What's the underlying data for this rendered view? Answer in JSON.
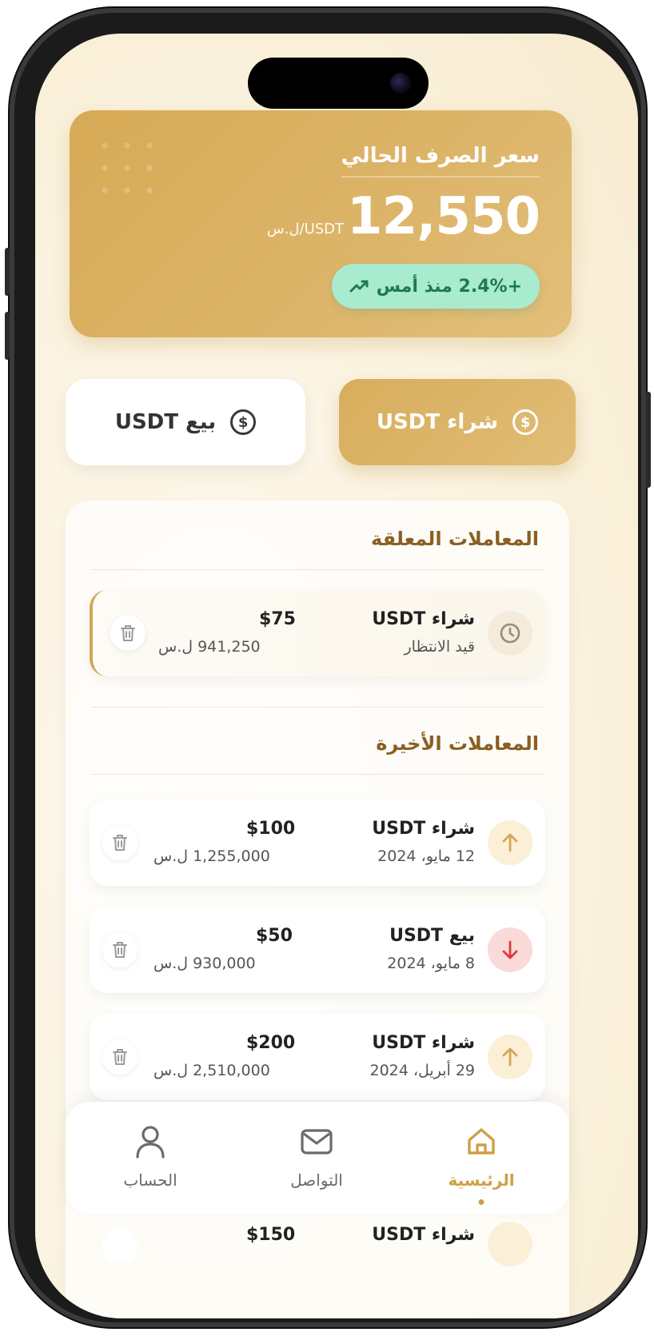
{
  "rate": {
    "title": "سعر الصرف الحالي",
    "value": "12,550",
    "unit": "ل.س/USDT",
    "change": "+2.4% منذ أمس"
  },
  "actions": {
    "buy_label": "شراء USDT",
    "sell_label": "بيع USDT"
  },
  "pending": {
    "title": "المعاملات المعلقة",
    "items": [
      {
        "title": "شراء USDT",
        "status": "قيد الانتظار",
        "amount": "$75",
        "lira": "941,250 ل.س"
      }
    ]
  },
  "recent": {
    "title": "المعاملات الأخيرة",
    "items": [
      {
        "title": "شراء USDT",
        "date": "12 مايو، 2024",
        "amount": "$100",
        "lira": "1,255,000 ل.س",
        "dir": "up"
      },
      {
        "title": "بيع USDT",
        "date": "8 مايو، 2024",
        "amount": "$50",
        "lira": "930,000 ل.س",
        "dir": "down"
      },
      {
        "title": "شراء USDT",
        "date": "29 أبريل، 2024",
        "amount": "$200",
        "lira": "2,510,000 ل.س",
        "dir": "up"
      },
      {
        "title": "شراء USDT",
        "amount": "$150",
        "dir": "up"
      }
    ]
  },
  "nav": {
    "home": "الرئيسية",
    "contact": "التواصل",
    "account": "الحساب"
  },
  "colors": {
    "accent": "#d4a656",
    "positive": "#1f7a4d",
    "negative": "#e03a3a"
  }
}
